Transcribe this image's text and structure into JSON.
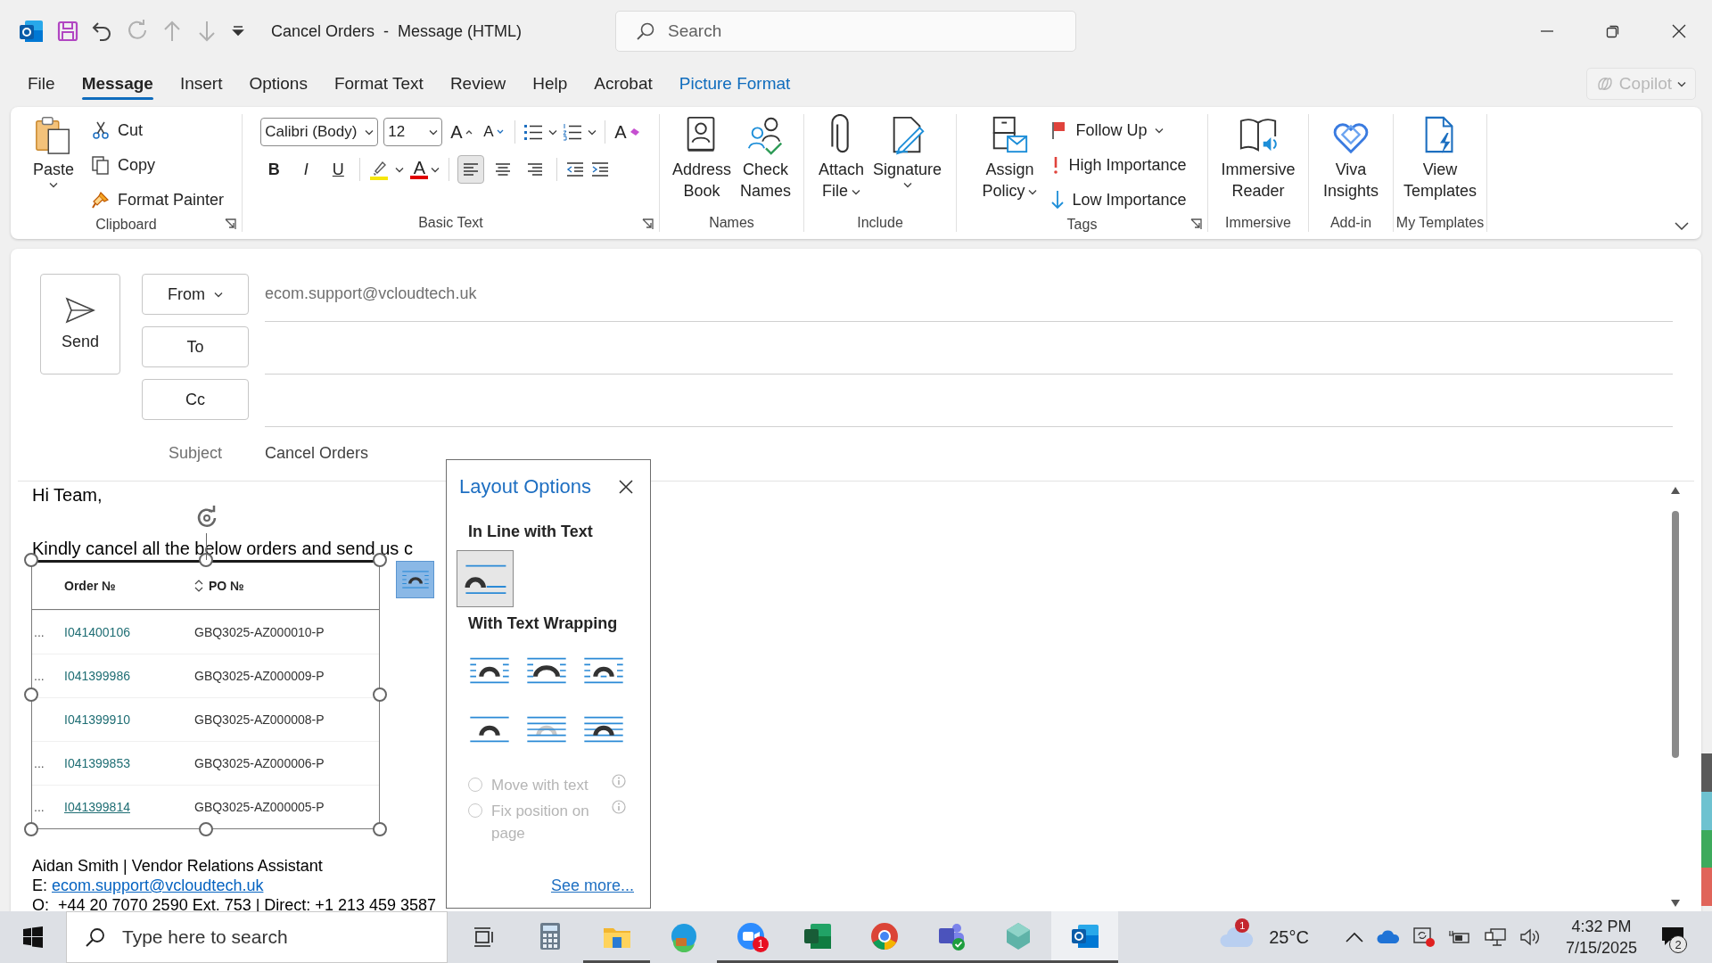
{
  "title_bar": {
    "title": "Cancel Orders  -  Message (HTML)",
    "quick_access": [
      {
        "disabled": false
      },
      {
        "disabled": false
      },
      {
        "disabled": true
      },
      {
        "disabled": true
      },
      {
        "disabled": true
      }
    ],
    "search": {
      "placeholder": "Search"
    }
  },
  "menu_tabs": [
    {
      "label": "File",
      "selected": false,
      "kind": "normal"
    },
    {
      "label": "Message",
      "selected": true,
      "kind": "normal"
    },
    {
      "label": "Insert",
      "selected": false,
      "kind": "normal"
    },
    {
      "label": "Options",
      "selected": false,
      "kind": "normal"
    },
    {
      "label": "Format Text",
      "selected": false,
      "kind": "normal"
    },
    {
      "label": "Review",
      "selected": false,
      "kind": "normal"
    },
    {
      "label": "Help",
      "selected": false,
      "kind": "normal"
    },
    {
      "label": "Acrobat",
      "selected": false,
      "kind": "normal"
    },
    {
      "label": "Picture Format",
      "selected": false,
      "kind": "contextual"
    }
  ],
  "copilot": {
    "label": "Copilot",
    "disabled": true
  },
  "ribbon": {
    "clipboard": {
      "label": "Clipboard",
      "paste": "Paste",
      "items": [
        "Cut",
        "Copy",
        "Format Painter"
      ]
    },
    "basic_text": {
      "label": "Basic Text",
      "font": "Calibri (Body)",
      "size": "12",
      "grow": "A",
      "shrink": "A",
      "clear": "A",
      "bold": "B",
      "italic": "I",
      "underline": "U",
      "font_color": "A",
      "alignment": [
        {
          "selected": true
        },
        {
          "selected": false
        },
        {
          "selected": false
        }
      ]
    },
    "names": {
      "label": "Names",
      "buttons": [
        "Address Book",
        "Check Names"
      ]
    },
    "include": {
      "label": "Include",
      "buttons": [
        "Attach File",
        "Signature"
      ]
    },
    "tags": {
      "label": "Tags",
      "assign": "Assign Policy",
      "items": [
        "Follow Up",
        "High Importance",
        "Low Importance"
      ]
    },
    "immersive": {
      "label": "Immersive",
      "button": "Immersive Reader"
    },
    "add_in": {
      "label": "Add-in",
      "button": "Viva Insights"
    },
    "my_templates": {
      "label": "My Templates",
      "button": "View Templates"
    }
  },
  "compose": {
    "send": "Send",
    "from": {
      "label": "From",
      "value": "ecom.support@vcloudtech.uk"
    },
    "to": {
      "label": "To"
    },
    "cc": {
      "label": "Cc"
    },
    "subject": {
      "label": "Subject",
      "value": "Cancel Orders"
    }
  },
  "body": {
    "greeting": "Hi Team,",
    "line": "Kindly cancel all the below orders and send us c",
    "table": {
      "columns": [
        "Order №",
        "PO №"
      ],
      "rows": [
        {
          "marker": "...",
          "order": "I041400106",
          "po": "GBQ3025-AZ000010-P",
          "hovered": false
        },
        {
          "marker": "...",
          "order": "I041399986",
          "po": "GBQ3025-AZ000009-P",
          "hovered": false
        },
        {
          "order": "I041399910",
          "po": "GBQ3025-AZ000008-P",
          "hovered": false
        },
        {
          "marker": "...",
          "order": "I041399853",
          "po": "GBQ3025-AZ000006-P",
          "hovered": false
        },
        {
          "marker": "...",
          "order": "I041399814",
          "po": "GBQ3025-AZ000005-P",
          "hovered": true
        }
      ]
    },
    "signature": {
      "name_line": "Aidan Smith | Vendor Relations Assistant",
      "email_prefix": "E: ",
      "email": "ecom.support@vcloudtech.uk",
      "phone": "O:  +44 20 7070 2590 Ext. 753 | Direct: +1 213 459 3587"
    }
  },
  "layout_options": {
    "title": "Layout Options",
    "inline_heading": "In Line with Text",
    "inline_options": [
      {
        "selected": true
      }
    ],
    "wrap_heading": "With Text Wrapping",
    "wrap_options": [
      {
        "selected": false
      },
      {
        "selected": false
      },
      {
        "selected": false
      },
      {
        "selected": false
      },
      {
        "selected": false
      },
      {
        "selected": false
      }
    ],
    "radios": [
      {
        "label": "Move with text",
        "checked": false,
        "disabled": true
      },
      {
        "label": "Fix position on page",
        "checked": false,
        "disabled": true
      }
    ],
    "see_more": "See more..."
  },
  "taskbar": {
    "search": {
      "placeholder": "Type here to search"
    },
    "apps": [
      {
        "running": false,
        "selected": false
      },
      {
        "running": true,
        "selected": false
      },
      {
        "running": false,
        "selected": false
      },
      {
        "running": true,
        "selected": false,
        "badge": "1"
      },
      {
        "running": true,
        "selected": false
      },
      {
        "running": true,
        "selected": false
      },
      {
        "running": true,
        "selected": false
      },
      {
        "running": true,
        "selected": false
      },
      {
        "running": true,
        "selected": true
      }
    ],
    "weather": {
      "badge": "1",
      "temperature": "25°C"
    },
    "clock": {
      "time": "4:32 PM",
      "date": "7/15/2025"
    },
    "notifications": {
      "count": "2"
    }
  }
}
